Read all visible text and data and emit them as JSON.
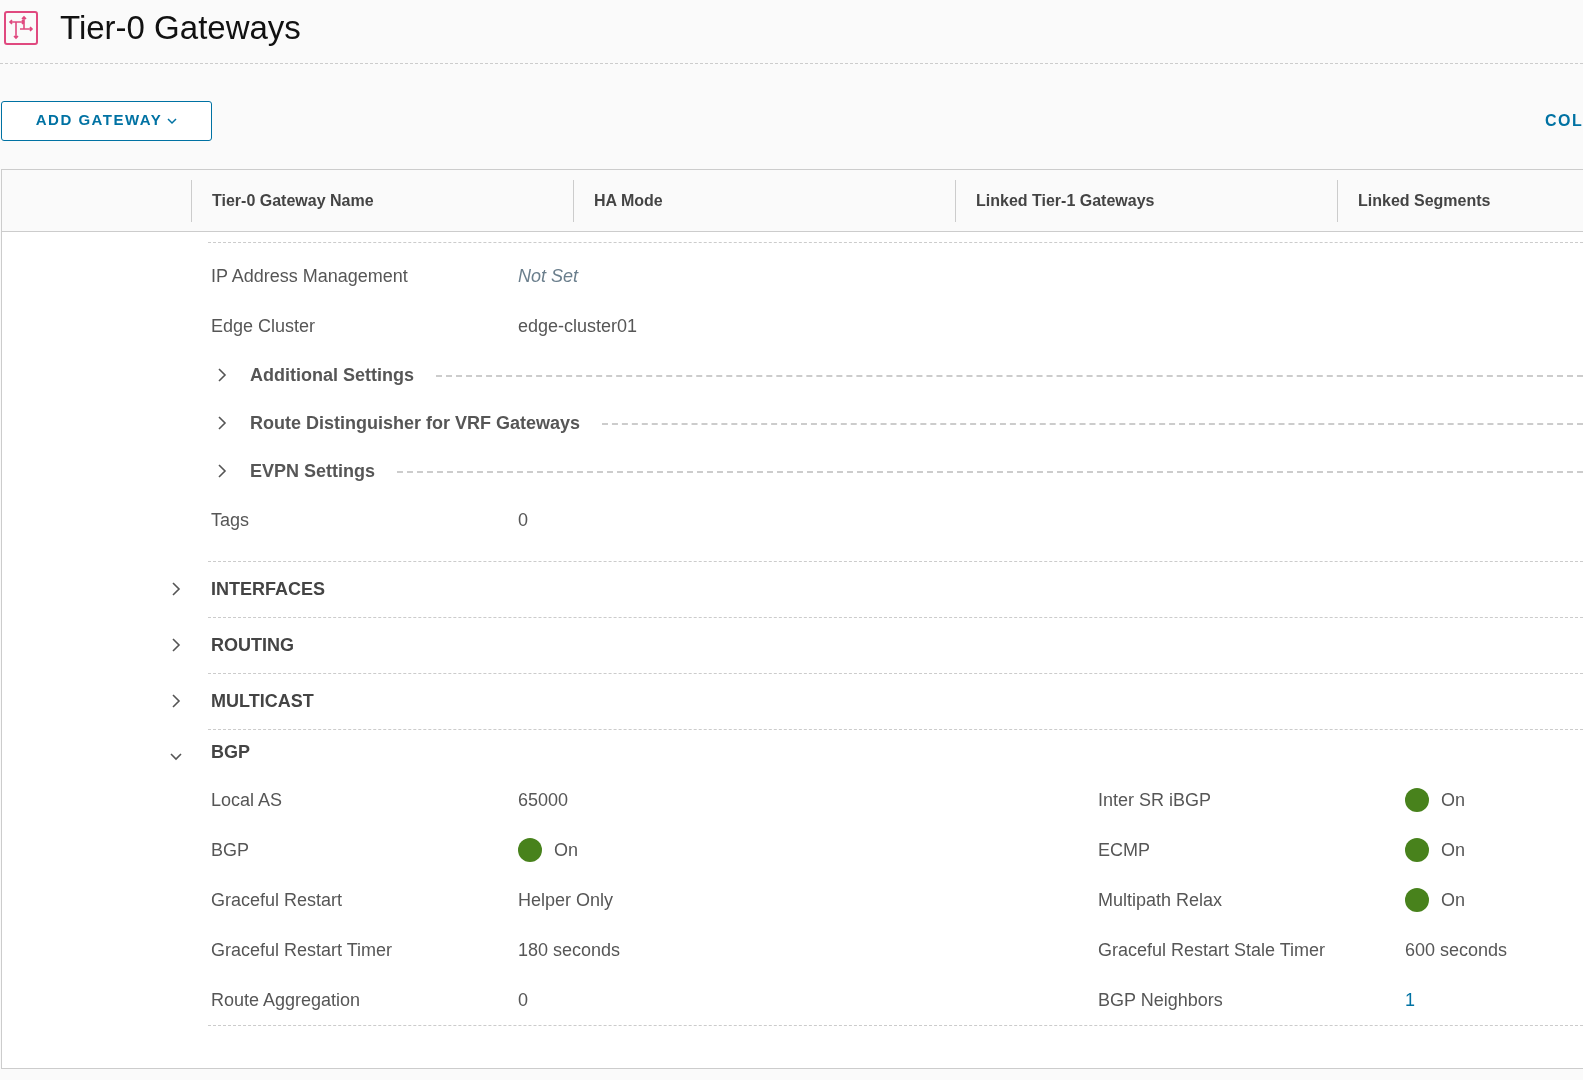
{
  "page": {
    "title": "Tier-0 Gateways"
  },
  "toolbar": {
    "add_button": "ADD GATEWAY",
    "right_link": "COL"
  },
  "table": {
    "columns": [
      "Tier-0 Gateway Name",
      "HA Mode",
      "Linked Tier-1 Gateways",
      "Linked Segments"
    ]
  },
  "details": [
    {
      "kind": "field",
      "label": "IP Address Management",
      "value": "Not Set",
      "placeholder_style": true
    },
    {
      "kind": "field",
      "label": "Edge Cluster",
      "value": "edge-cluster01",
      "placeholder_style": false
    },
    {
      "kind": "subsection",
      "label": "Additional Settings",
      "expanded": false
    },
    {
      "kind": "subsection",
      "label": "Route Distinguisher for VRF Gateways",
      "expanded": false
    },
    {
      "kind": "subsection",
      "label": "EVPN Settings",
      "expanded": false
    },
    {
      "kind": "field",
      "label": "Tags",
      "value": "0",
      "placeholder_style": false
    }
  ],
  "sections": [
    {
      "label": "INTERFACES",
      "expanded": false
    },
    {
      "label": "ROUTING",
      "expanded": false
    },
    {
      "label": "MULTICAST",
      "expanded": false
    },
    {
      "label": "BGP",
      "expanded": true,
      "rows": [
        {
          "left": {
            "kind": "text",
            "label": "Local AS",
            "value": "65000"
          },
          "right": {
            "kind": "status",
            "label": "Inter SR iBGP",
            "value": "On",
            "on": true
          }
        },
        {
          "left": {
            "kind": "status",
            "label": "BGP",
            "value": "On",
            "on": true
          },
          "right": {
            "kind": "status",
            "label": "ECMP",
            "value": "On",
            "on": true
          }
        },
        {
          "left": {
            "kind": "text",
            "label": "Graceful Restart",
            "value": "Helper Only"
          },
          "right": {
            "kind": "status",
            "label": "Multipath Relax",
            "value": "On",
            "on": true
          }
        },
        {
          "left": {
            "kind": "text",
            "label": "Graceful Restart Timer",
            "value": "180 seconds"
          },
          "right": {
            "kind": "text",
            "label": "Graceful Restart Stale Timer",
            "value": "600 seconds"
          }
        },
        {
          "left": {
            "kind": "text",
            "label": "Route Aggregation",
            "value": "0"
          },
          "right": {
            "kind": "link",
            "label": "BGP Neighbors",
            "value": "1"
          }
        }
      ]
    }
  ]
}
